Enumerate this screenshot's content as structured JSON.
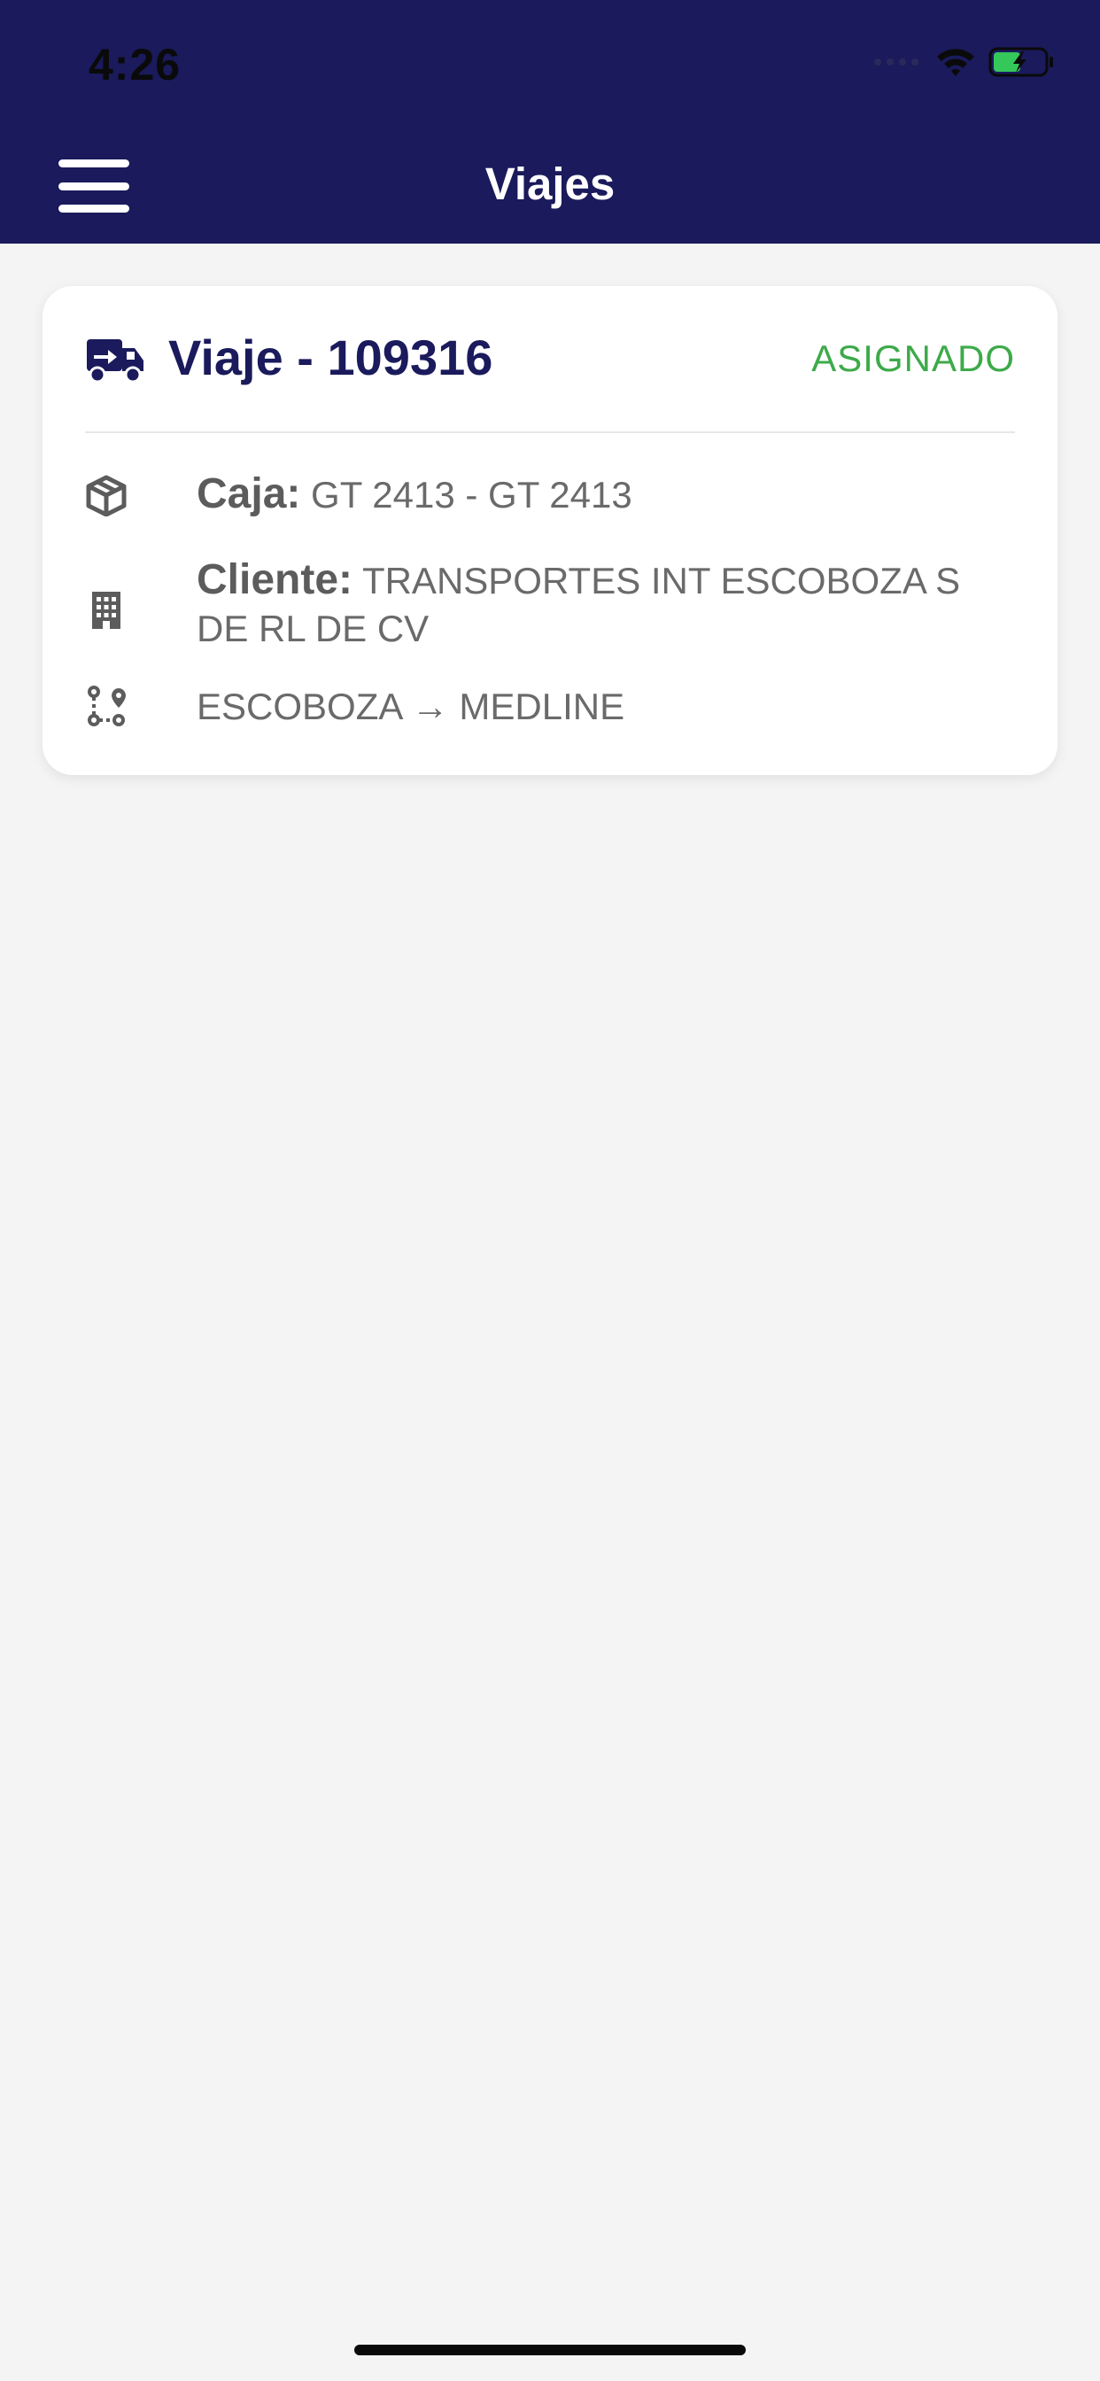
{
  "status_bar": {
    "time": "4:26"
  },
  "header": {
    "title": "Viajes"
  },
  "trip": {
    "title": "Viaje - 109316",
    "status": "ASIGNADO",
    "caja_label": "Caja:",
    "caja_value": "GT 2413 - GT 2413",
    "cliente_label": "Cliente:",
    "cliente_value": "TRANSPORTES INT ESCOBOZA S DE RL DE CV",
    "route": "ESCOBOZA → MEDLINE"
  },
  "colors": {
    "header_bg": "#1a1a5c",
    "status_green": "#3daa4a",
    "background": "#f4f4f4"
  },
  "icons": [
    "menu-icon",
    "truck-icon",
    "box-icon",
    "building-icon",
    "route-icon",
    "wifi-icon",
    "battery-icon",
    "cellular-icon"
  ]
}
